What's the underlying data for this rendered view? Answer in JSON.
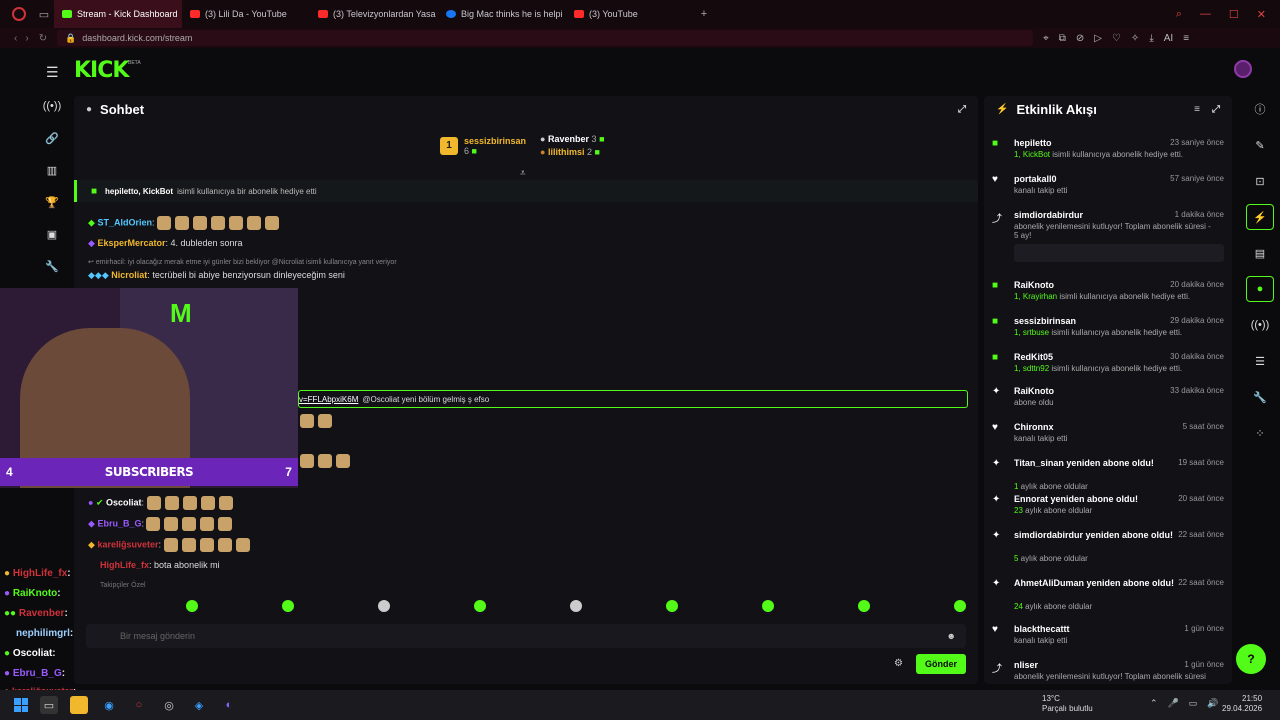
{
  "browser": {
    "tabs": [
      {
        "label": "Stream - Kick Dashboard",
        "color": "#53fc18",
        "active": true
      },
      {
        "label": "(3) Lili Da - YouTube",
        "color": "#ff2a2a",
        "active": false
      },
      {
        "label": "(3) Televizyonlardan Yasa",
        "color": "#ff2a2a",
        "active": false
      },
      {
        "label": "Big Mac thinks he is helpi",
        "color": "#1877f2",
        "active": false
      },
      {
        "label": "(3) YouTube",
        "color": "#ff2a2a",
        "active": false
      }
    ],
    "url": "dashboard.kick.com/stream",
    "ai_label": "AI"
  },
  "kick": {
    "logo": "KICK",
    "beta": "BETA"
  },
  "chat": {
    "title": "Sohbet",
    "leaderboard": {
      "first": {
        "rank": "1",
        "name": "sessizbirinsan",
        "count": "6"
      },
      "second": {
        "name": "Ravenber",
        "count": "3"
      },
      "third": {
        "name": "lilithimsi",
        "count": "2"
      }
    },
    "pinned": {
      "names": "hepiletto, KickBot",
      "text": "isimli kullanıcıya bir abonelik hediye etti"
    },
    "messages": [
      {
        "user": "ST_AldOrien",
        "color": "#53c8ff",
        "text": ""
      },
      {
        "user": "EksperMercator",
        "color": "#f1b82d",
        "text": "4. dubleden sonra"
      },
      {
        "user": "emirhacil",
        "color": "#999",
        "text": "iyi olacağız merak etme iyi günler bizi bekliyor @Nicroliat isimli kullanıcıya yanıt veriyor"
      },
      {
        "user": "Nicroliat",
        "color": "#f1b82d",
        "text": "tecrübeli bi abiye benziyorsun dinleyeceğim seni"
      },
      {
        "user": "",
        "color": "#53fc18",
        "text": "v=FFLAbpxiK6M"
      },
      {
        "user": "",
        "color": "#ddd",
        "text": "@Oscoliat yeni bölüm gelmiş ş efso"
      },
      {
        "user": "Oscoliat",
        "color": "#ffffff",
        "text": ""
      },
      {
        "user": "Ebru_B_G",
        "color": "#9b59ff",
        "text": ""
      },
      {
        "user": "kareliğsuveter",
        "color": "#d0323a",
        "text": ""
      },
      {
        "user": "HighLife_fx",
        "color": "#d0323a",
        "text": "bota abonelik mi"
      }
    ],
    "input_placeholder": "Bir mesaj gönderin",
    "send_label": "Gönder",
    "fade_text": "Takipçiler Özel"
  },
  "webcam": {
    "sub_label": "SUBSCRIBERS",
    "left_num": "4",
    "right_num": "7"
  },
  "overlay_chat": [
    {
      "name": "HighLife_fx",
      "color": "#d0323a"
    },
    {
      "name": "RaiKnoto",
      "color": "#53fc18"
    },
    {
      "name": "Ravenber",
      "color": "#d0323a"
    },
    {
      "name": "nephilimgrl",
      "color": "#9bd0ff"
    },
    {
      "name": "Oscoliat",
      "color": "#ffffff"
    },
    {
      "name": "Ebru_B_G",
      "color": "#9b59ff"
    },
    {
      "name": "kareliğsuveter",
      "color": "#d0323a"
    }
  ],
  "feed": {
    "title": "Etkinlik Akışı",
    "items": [
      {
        "icon": "gift",
        "name": "hepiletto",
        "time": "23 saniye önce",
        "highlight": "1, KickBot",
        "desc": " isimli kullanıcıya abonelik hediye etti."
      },
      {
        "icon": "heart",
        "name": "portakall0",
        "time": "57 saniye önce",
        "highlight": "",
        "desc": "kanalı takip etti"
      },
      {
        "icon": "renew",
        "name": "simdiordabirdur",
        "time": "1 dakika önce",
        "highlight": "",
        "desc": "abonelik yenilemesini kutluyor! Toplam abonelik süresi - 5 ay!"
      },
      {
        "icon": "gift",
        "name": "RaiKnoto",
        "time": "20 dakika önce",
        "highlight": "1, Krayirhan",
        "desc": " isimli kullanıcıya abonelik hediye etti."
      },
      {
        "icon": "gift",
        "name": "sessizbirinsan",
        "time": "29 dakika önce",
        "highlight": "1, srtbuse",
        "desc": " isimli kullanıcıya abonelik hediye etti."
      },
      {
        "icon": "gift",
        "name": "RedKit05",
        "time": "30 dakika önce",
        "highlight": "1, sdttn92",
        "desc": " isimli kullanıcıya abonelik hediye etti."
      },
      {
        "icon": "star",
        "name": "RaiKnoto",
        "time": "33 dakika önce",
        "highlight": "",
        "desc": "abone oldu"
      },
      {
        "icon": "heart",
        "name": "Chironnx",
        "time": "5 saat önce",
        "highlight": "",
        "desc": "kanalı takip etti"
      },
      {
        "icon": "star",
        "name": "Titan_sinan yeniden abone oldu!",
        "time": "19 saat önce",
        "highlight": "1",
        "desc": " aylık abone oldular"
      },
      {
        "icon": "star",
        "name": "Ennorat yeniden abone oldu!",
        "time": "20 saat önce",
        "highlight": "23",
        "desc": " aylık abone oldular"
      },
      {
        "icon": "star",
        "name": "simdiordabirdur yeniden abone oldu!",
        "time": "22 saat önce",
        "highlight": "5",
        "desc": " aylık abone oldular"
      },
      {
        "icon": "star",
        "name": "AhmetAliDuman yeniden abone oldu!",
        "time": "22 saat önce",
        "highlight": "24",
        "desc": " aylık abone oldular"
      },
      {
        "icon": "heart",
        "name": "blackthecattt",
        "time": "1 gün önce",
        "highlight": "",
        "desc": "kanalı takip etti"
      },
      {
        "icon": "renew",
        "name": "nliser",
        "time": "1 gün önce",
        "highlight": "",
        "desc": "abonelik yenilemesini kutluyor! Toplam abonelik süresi"
      }
    ]
  },
  "taskbar": {
    "weather_temp": "13°C",
    "weather_desc": "Parçalı bulutlu",
    "time": "21:50",
    "date": "29.04.2026"
  }
}
